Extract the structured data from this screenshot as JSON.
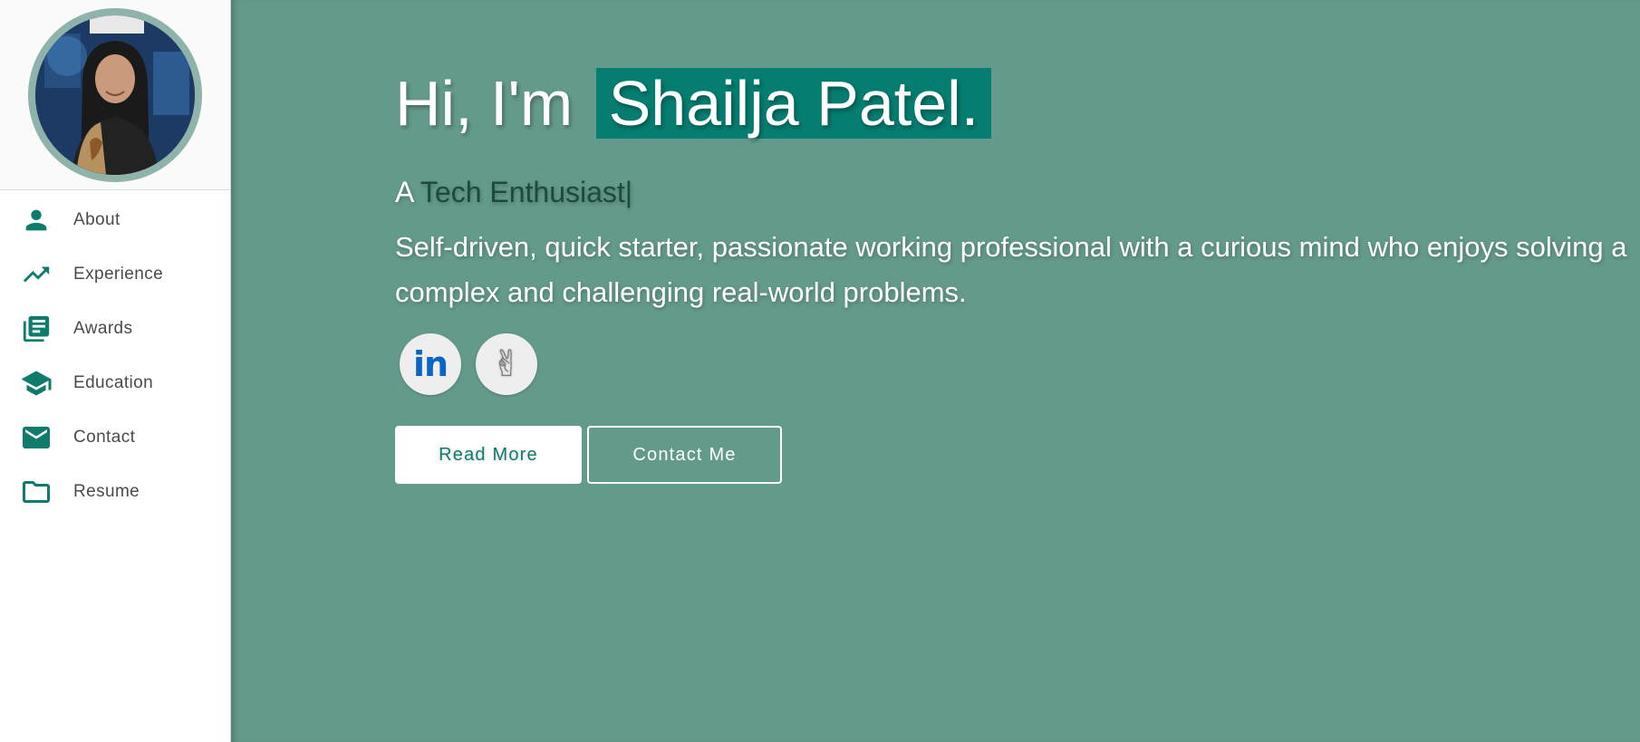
{
  "sidebar": {
    "avatar_alt": "Profile photo",
    "items": [
      {
        "label": "About",
        "icon": "person-icon"
      },
      {
        "label": "Experience",
        "icon": "trending-up-icon"
      },
      {
        "label": "Awards",
        "icon": "library-books-icon"
      },
      {
        "label": "Education",
        "icon": "school-icon"
      },
      {
        "label": "Contact",
        "icon": "mail-icon"
      },
      {
        "label": "Resume",
        "icon": "folder-icon"
      }
    ]
  },
  "hero": {
    "greeting": "Hi, I'm",
    "name": "Shailja Patel.",
    "tagline_prefix": "A",
    "tagline_role": "Tech Enthusiast",
    "tagline_cursor": "|",
    "bio": "Self-driven, quick starter, passionate working professional with a curious mind who enjoys solving a complex and challenging real-world problems.",
    "socials": [
      {
        "name": "linkedin-icon",
        "text": "in"
      },
      {
        "name": "peace-hand-icon",
        "text": "✌"
      }
    ],
    "read_more_label": "Read More",
    "contact_label": "Contact Me"
  },
  "colors": {
    "main_bg": "#649a8c",
    "accent": "#057d70",
    "sidebar_icon": "#0e7b6c",
    "linkedin": "#0a66c2"
  }
}
